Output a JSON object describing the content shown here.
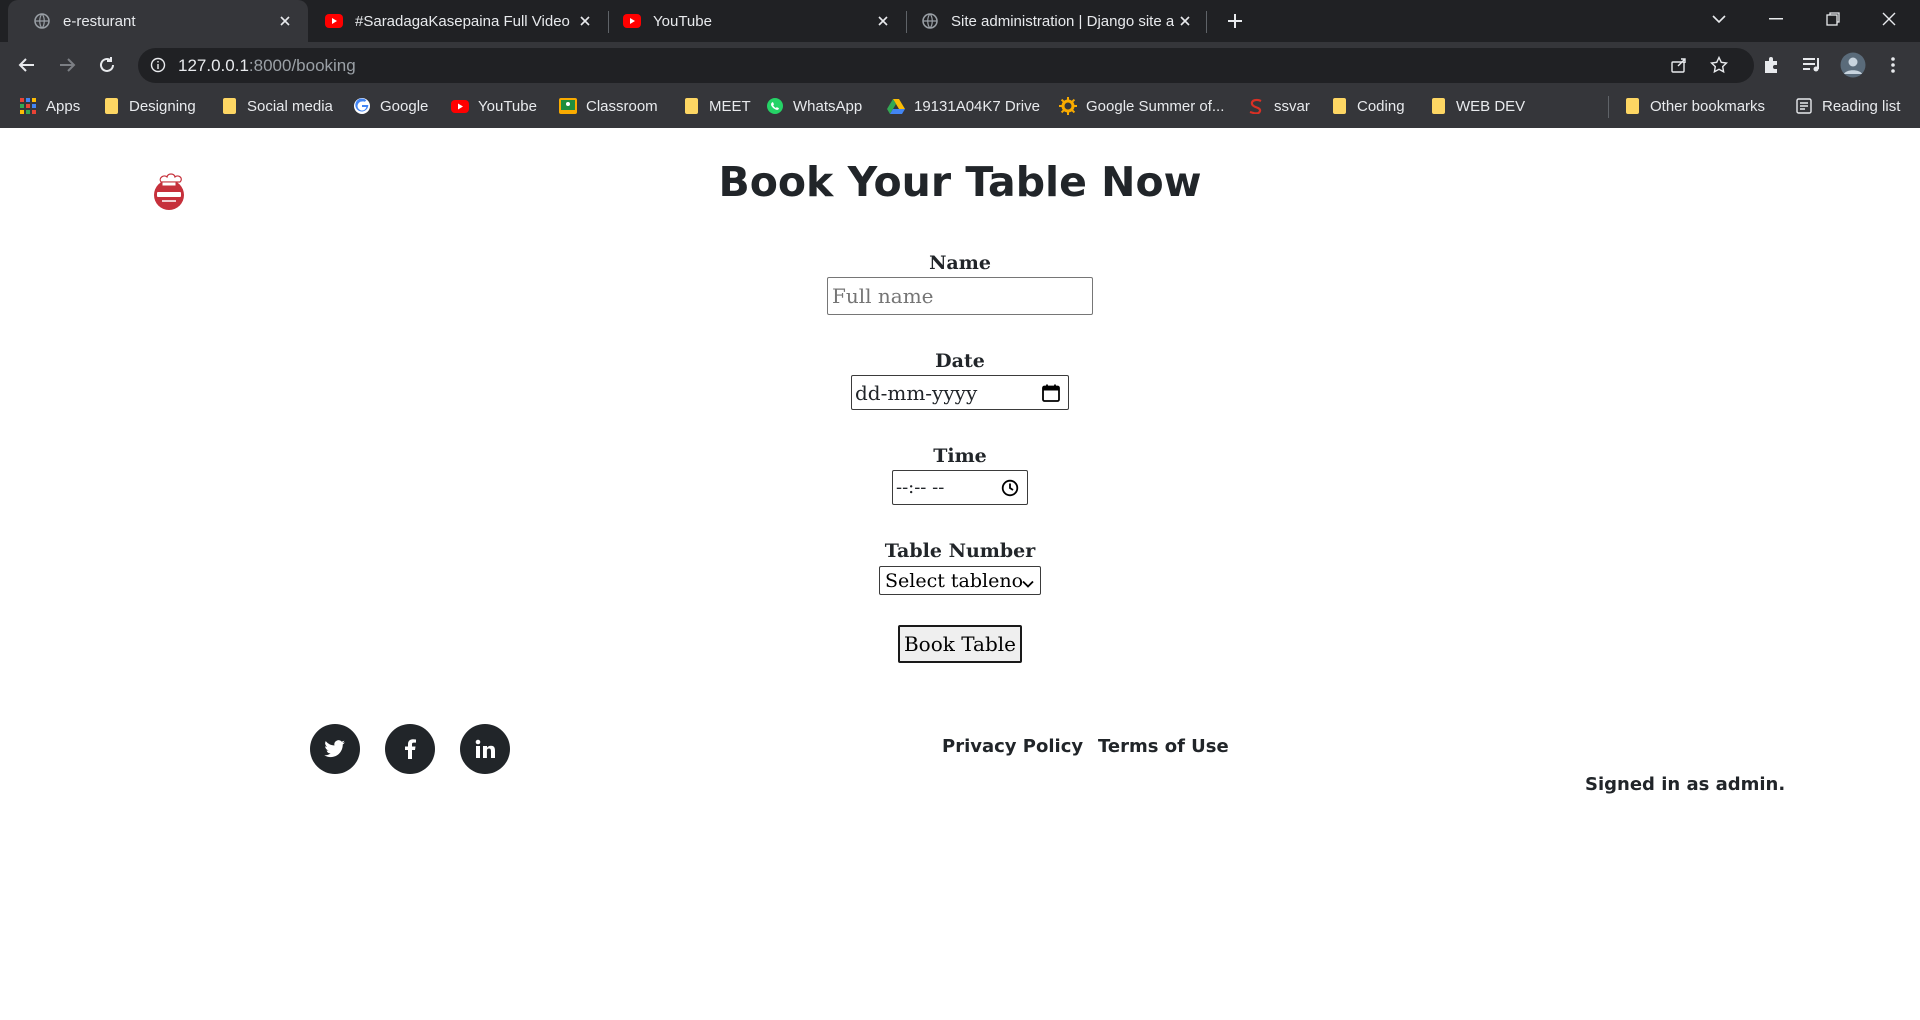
{
  "browser": {
    "tabs": [
      {
        "title": "e-resturant",
        "active": true,
        "favicon": "globe-icon"
      },
      {
        "title": "#SaradagaKasepaina Full Video S",
        "active": false,
        "favicon": "youtube-icon"
      },
      {
        "title": "YouTube",
        "active": false,
        "favicon": "youtube-icon"
      },
      {
        "title": "Site administration | Django site a",
        "active": false,
        "favicon": "globe-icon"
      }
    ],
    "url_host": "127.0.0.1",
    "url_path": ":8000/booking",
    "bookmarks": [
      {
        "label": "Apps",
        "icon": "apps-grid-icon"
      },
      {
        "label": "Designing",
        "icon": "folder-icon"
      },
      {
        "label": "Social media",
        "icon": "folder-icon"
      },
      {
        "label": "Google",
        "icon": "google-icon"
      },
      {
        "label": "YouTube",
        "icon": "youtube-icon"
      },
      {
        "label": "Classroom",
        "icon": "classroom-icon"
      },
      {
        "label": "MEET",
        "icon": "folder-icon"
      },
      {
        "label": "WhatsApp",
        "icon": "whatsapp-icon"
      },
      {
        "label": "19131A04K7 Drive",
        "icon": "drive-icon"
      },
      {
        "label": "Google Summer of...",
        "icon": "gsoc-icon"
      },
      {
        "label": "ssvar",
        "icon": "ssvar-icon"
      },
      {
        "label": "Coding",
        "icon": "folder-icon"
      },
      {
        "label": "WEB DEV",
        "icon": "folder-icon"
      }
    ],
    "other_bookmarks": "Other bookmarks",
    "reading_list": "Reading list"
  },
  "page": {
    "heading": "Book Your Table Now",
    "form": {
      "name_label": "Name",
      "name_placeholder": "Full name",
      "date_label": "Date",
      "date_placeholder": "dd-mm-yyyy",
      "time_label": "Time",
      "time_placeholder": "--:-- --",
      "table_label": "Table Number",
      "table_selected": "Select tableno",
      "submit_label": "Book Table"
    },
    "footer": {
      "social": [
        "twitter-icon",
        "facebook-icon",
        "linkedin-icon"
      ],
      "privacy": "Privacy Policy",
      "terms": "Terms of Use",
      "signed_in": "Signed in as admin."
    }
  }
}
